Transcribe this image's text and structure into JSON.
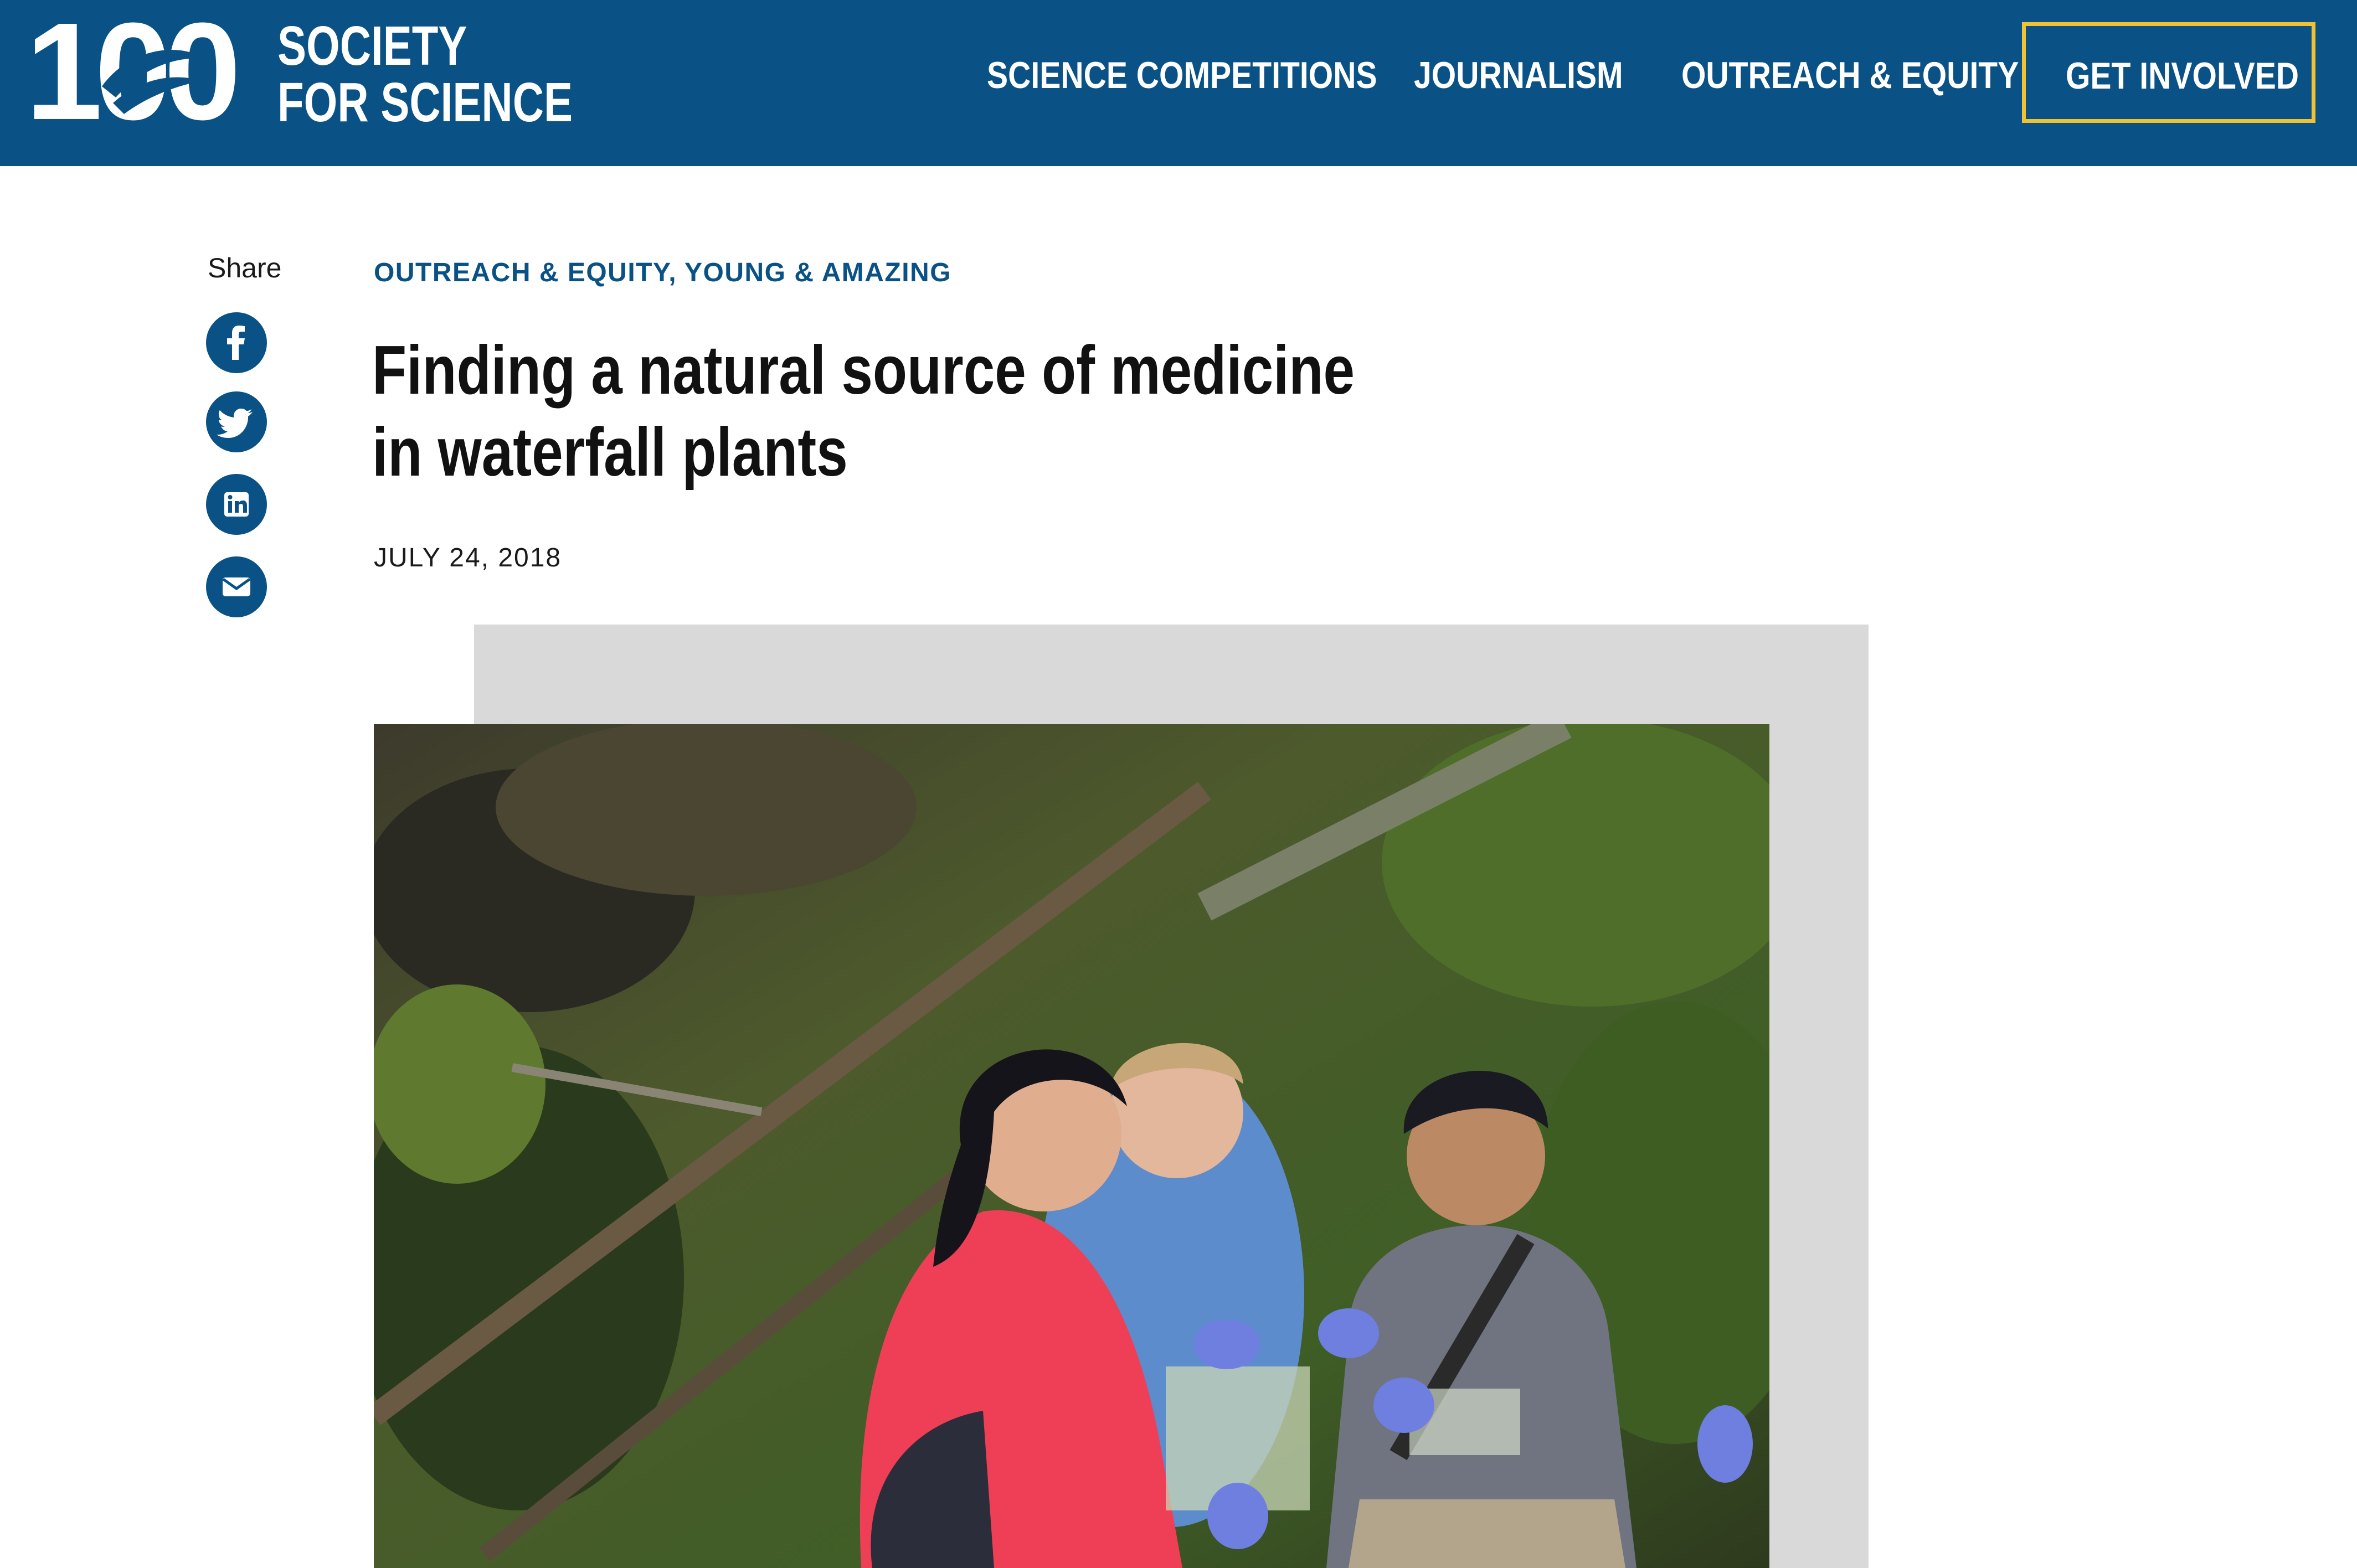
{
  "header": {
    "logo": {
      "number": "100",
      "line1": "SOCIETY",
      "line2": "FOR SCIENCE"
    },
    "nav": [
      {
        "label": "SCIENCE COMPETITIONS"
      },
      {
        "label": "JOURNALISM"
      },
      {
        "label": "OUTREACH & EQUITY"
      }
    ],
    "cta_label": "GET INVOLVED"
  },
  "share": {
    "label": "Share",
    "buttons": [
      {
        "icon": "facebook-icon"
      },
      {
        "icon": "twitter-icon"
      },
      {
        "icon": "linkedin-icon"
      },
      {
        "icon": "email-icon"
      }
    ]
  },
  "article": {
    "category": "OUTREACH & EQUITY, YOUNG & AMAZING",
    "title": "Finding a natural source of medicine in waterfall plants",
    "date": "JULY 24, 2018"
  },
  "colors": {
    "brand_blue": "#0a5286",
    "cta_border": "#f2c233",
    "photo_frame": "#d9d9d9"
  }
}
